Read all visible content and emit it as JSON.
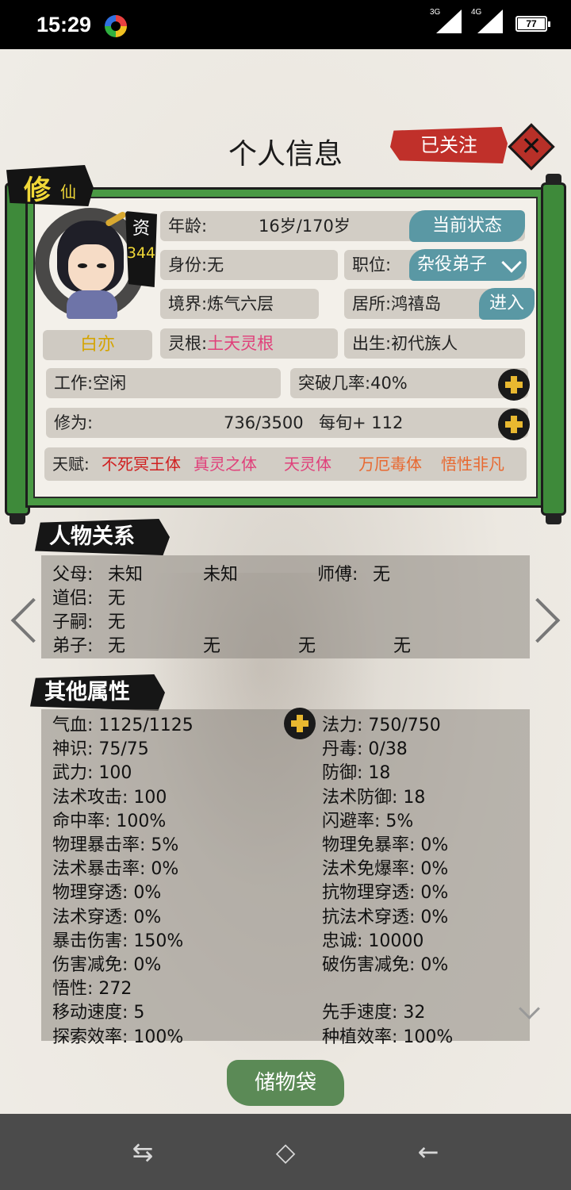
{
  "status_bar": {
    "time": "15:29",
    "signal_1": "3G",
    "signal_2": "4G",
    "battery": "77"
  },
  "header": {
    "title": "个人信息",
    "follow_label": "已关注",
    "close_icon": "close-icon"
  },
  "profile": {
    "tag_big": "修",
    "tag_small": "仙",
    "aptitude_label": "资",
    "aptitude_value": "344",
    "name": "白亦",
    "age_label": "年龄:",
    "age_value": "16岁/170岁",
    "status_button": "当前状态",
    "identity_label": "身份:",
    "identity_value": "无",
    "position_label": "职位:",
    "position_value": "杂役弟子",
    "realm_label": "境界:",
    "realm_value": "炼气六层",
    "residence_label": "居所:",
    "residence_value": "鸿禧岛",
    "enter_button": "进入",
    "root_label": "灵根:",
    "root_value": "土天灵根",
    "birth_label": "出生:",
    "birth_value": "初代族人",
    "work_label": "工作:",
    "work_value": "空闲",
    "breakthrough_label": "突破几率:",
    "breakthrough_value": "40%",
    "cultivation_label": "修为:",
    "cultivation_value": "736/3500",
    "per_period": "每旬+ 112",
    "talent_label": "天赋:",
    "talents": [
      {
        "name": "不死冥王体",
        "color": "#d02020"
      },
      {
        "name": "真灵之体",
        "color": "#e0407a"
      },
      {
        "name": "天灵体",
        "color": "#e0407a"
      },
      {
        "name": "万厄毒体",
        "color": "#e86830"
      },
      {
        "name": "悟性非凡",
        "color": "#e86830"
      }
    ]
  },
  "relations": {
    "title": "人物关系",
    "parents_label": "父母:",
    "parent_1": "未知",
    "parent_2": "未知",
    "master_label": "师傅:",
    "master_value": "无",
    "partner_label": "道侣:",
    "partner_value": "无",
    "children_label": "子嗣:",
    "children_value": "无",
    "disciples_label": "弟子:",
    "disciples": [
      "无",
      "无",
      "无",
      "无"
    ]
  },
  "attributes": {
    "title": "其他属性",
    "left": [
      "气血: 1125/1125",
      "神识: 75/75",
      "武力: 100",
      "法术攻击: 100",
      "命中率: 100%",
      "物理暴击率: 5%",
      "法术暴击率: 0%",
      "物理穿透: 0%",
      "法术穿透: 0%",
      "暴击伤害: 150%",
      "伤害减免: 0%",
      "悟性:  272",
      "移动速度: 5",
      "探索效率: 100%"
    ],
    "right": [
      "法力: 750/750",
      "丹毒: 0/38",
      "防御: 18",
      "法术防御: 18",
      "闪避率: 5%",
      "物理免暴率: 0%",
      "法术免爆率: 0%",
      "抗物理穿透: 0%",
      "抗法术穿透: 0%",
      "忠诚:  10000",
      "破伤害减免: 0%",
      "",
      "先手速度: 32",
      "种植效率: 100%"
    ]
  },
  "footer": {
    "bag_button": "储物袋"
  },
  "nav_bar": {
    "left_glyph": "⇆",
    "home_glyph": "◇",
    "back_glyph": "←"
  }
}
